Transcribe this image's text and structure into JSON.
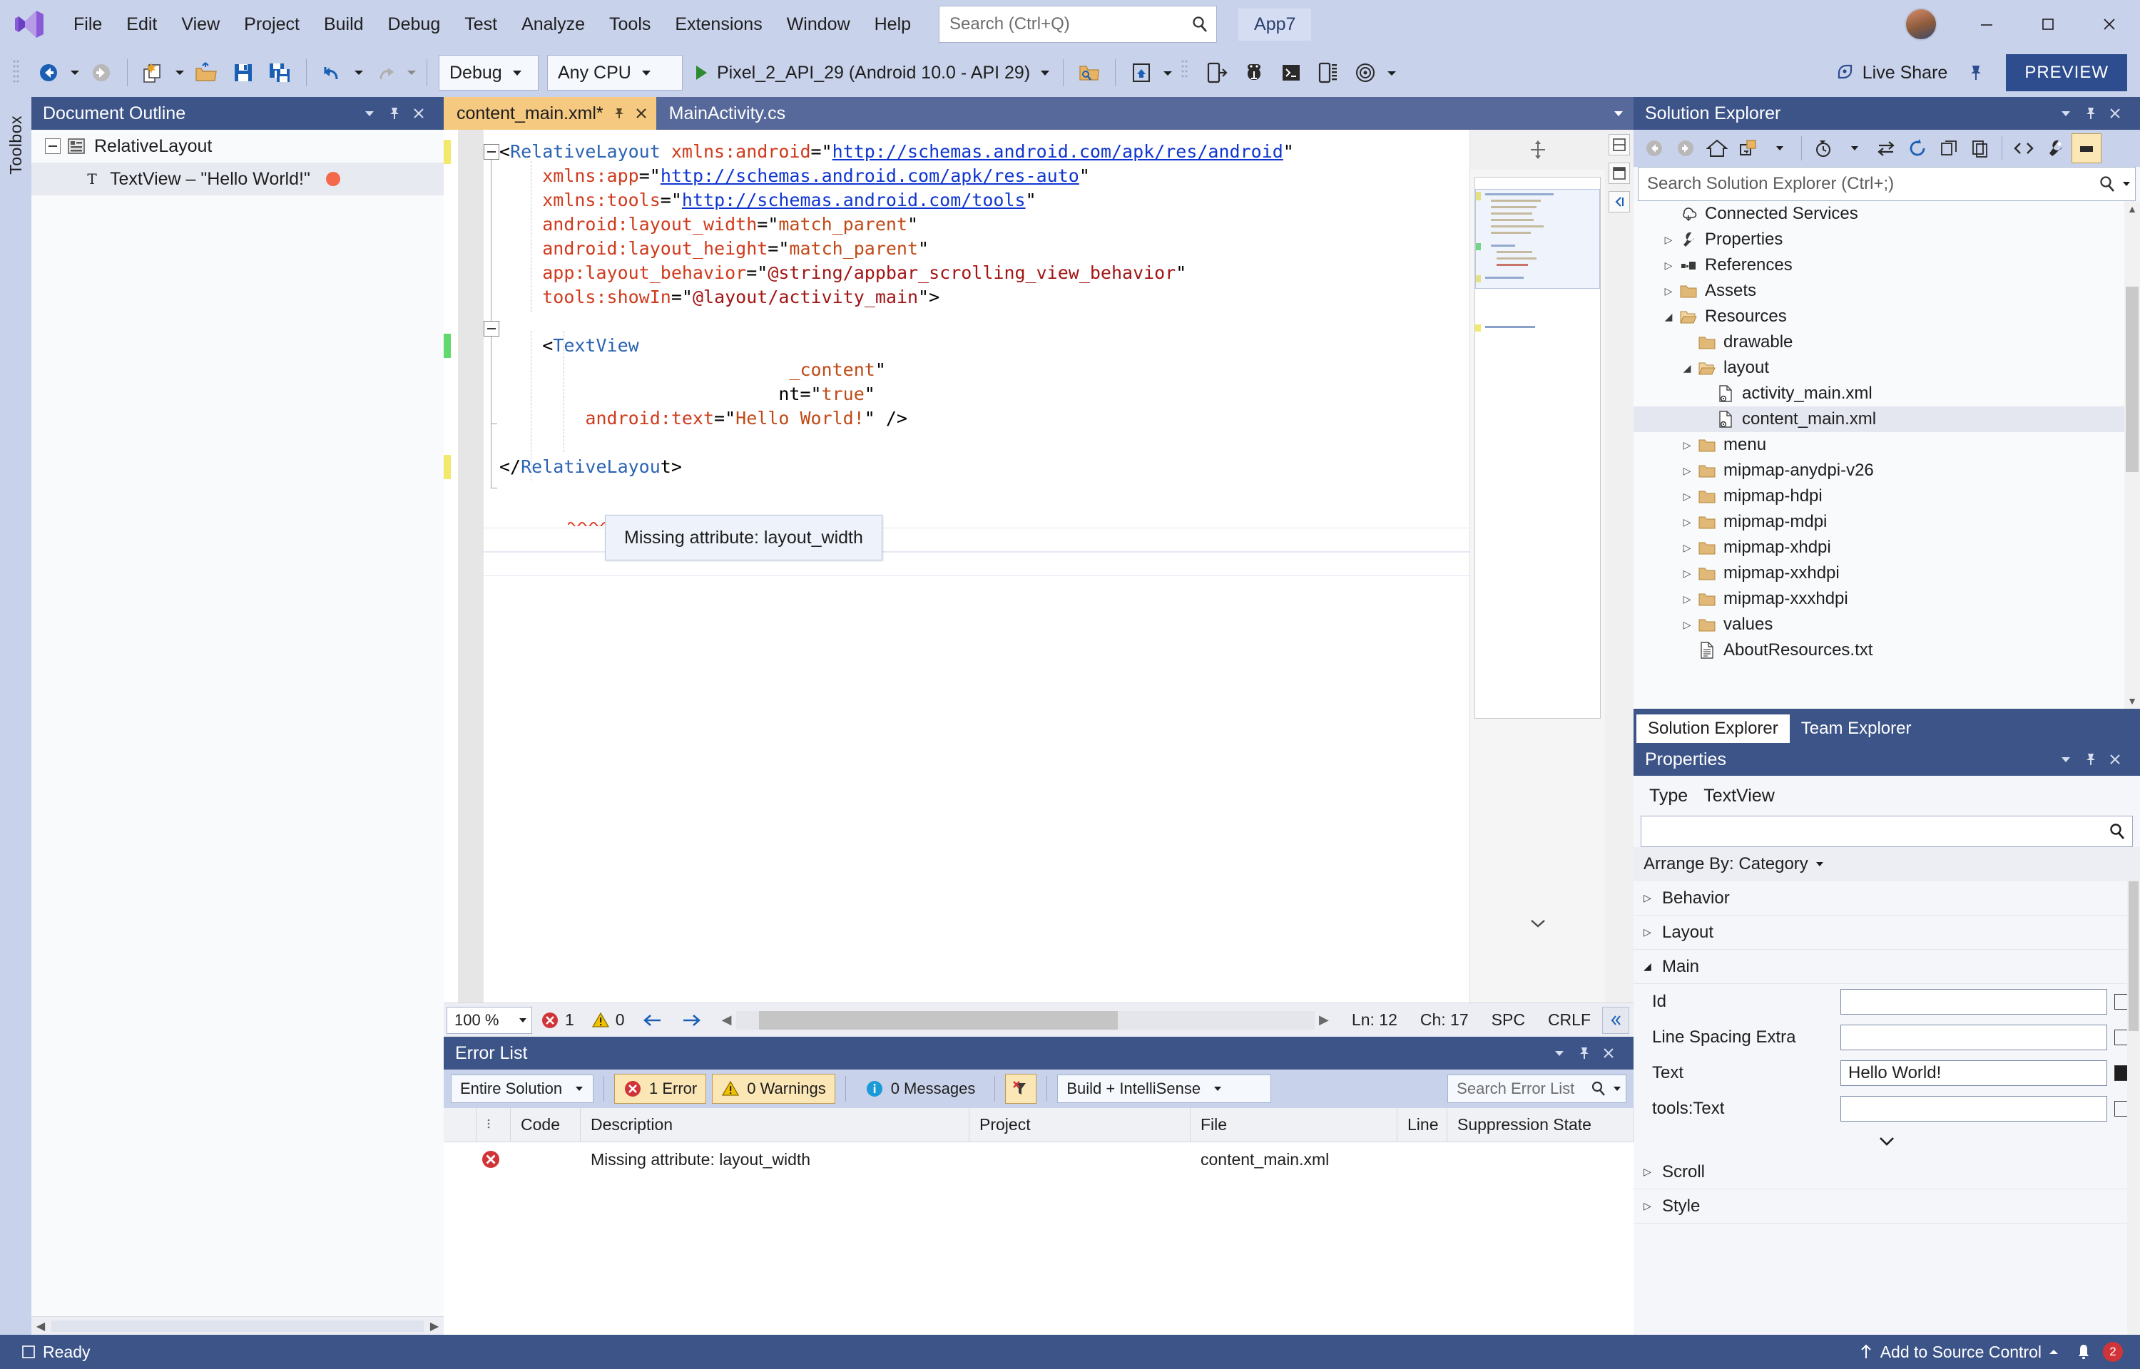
{
  "titlebar": {
    "logo_name": "visual-studio-logo",
    "menus": [
      "File",
      "Edit",
      "View",
      "Project",
      "Build",
      "Debug",
      "Test",
      "Analyze",
      "Tools",
      "Extensions",
      "Window",
      "Help"
    ],
    "search_placeholder": "Search (Ctrl+Q)",
    "project_badge": "App7",
    "minimize": "─",
    "maximize": "❐",
    "close": "✕"
  },
  "toolbar": {
    "configuration": "Debug",
    "platform": "Any CPU",
    "run_target": "Pixel_2_API_29 (Android 10.0 - API 29)",
    "live_share": "Live Share",
    "preview": "PREVIEW"
  },
  "toolbox": {
    "label": "Toolbox"
  },
  "document_outline": {
    "title": "Document Outline",
    "nodes": [
      {
        "label": "RelativeLayout",
        "icon": "layout-icon",
        "indent": 0,
        "selected": false,
        "dot": false
      },
      {
        "label": "TextView  –  \"Hello World!\"",
        "icon": "textview-icon",
        "indent": 1,
        "selected": true,
        "dot": true
      }
    ]
  },
  "editor": {
    "tabs": [
      {
        "label": "content_main.xml*",
        "active": true
      },
      {
        "label": "MainActivity.cs",
        "active": false
      }
    ],
    "tooltip": "Missing attribute: layout_width",
    "code_lines": [
      {
        "n": 1,
        "indent": 0,
        "tokens": [
          {
            "t": "punc",
            "v": "<"
          },
          {
            "t": "tag",
            "v": "RelativeLayout"
          },
          {
            "t": "plain",
            "v": " "
          },
          {
            "t": "attr",
            "v": "xmlns:android"
          },
          {
            "t": "punc",
            "v": "="
          },
          {
            "t": "strq",
            "v": "\""
          },
          {
            "t": "url",
            "v": "http://schemas.android.com/apk/res/android"
          },
          {
            "t": "strq",
            "v": "\""
          }
        ]
      },
      {
        "n": 2,
        "indent": 1,
        "tokens": [
          {
            "t": "attr",
            "v": "xmlns:app"
          },
          {
            "t": "punc",
            "v": "="
          },
          {
            "t": "strq",
            "v": "\""
          },
          {
            "t": "url",
            "v": "http://schemas.android.com/apk/res-auto"
          },
          {
            "t": "strq",
            "v": "\""
          }
        ]
      },
      {
        "n": 3,
        "indent": 1,
        "tokens": [
          {
            "t": "attr",
            "v": "xmlns:tools"
          },
          {
            "t": "punc",
            "v": "="
          },
          {
            "t": "strq",
            "v": "\""
          },
          {
            "t": "url",
            "v": "http://schemas.android.com/tools"
          },
          {
            "t": "strq",
            "v": "\""
          }
        ]
      },
      {
        "n": 4,
        "indent": 1,
        "tokens": [
          {
            "t": "attr",
            "v": "android:layout_width"
          },
          {
            "t": "punc",
            "v": "="
          },
          {
            "t": "strq",
            "v": "\""
          },
          {
            "t": "str",
            "v": "match_parent"
          },
          {
            "t": "strq",
            "v": "\""
          }
        ]
      },
      {
        "n": 5,
        "indent": 1,
        "tokens": [
          {
            "t": "attr",
            "v": "android:layout_height"
          },
          {
            "t": "punc",
            "v": "="
          },
          {
            "t": "strq",
            "v": "\""
          },
          {
            "t": "str",
            "v": "match_parent"
          },
          {
            "t": "strq",
            "v": "\""
          }
        ]
      },
      {
        "n": 6,
        "indent": 1,
        "tokens": [
          {
            "t": "attr",
            "v": "app:layout_behavior"
          },
          {
            "t": "punc",
            "v": "="
          },
          {
            "t": "strq",
            "v": "\""
          },
          {
            "t": "res",
            "v": "@string/appbar_scrolling_view_behavior"
          },
          {
            "t": "strq",
            "v": "\""
          }
        ]
      },
      {
        "n": 7,
        "indent": 1,
        "tokens": [
          {
            "t": "attr",
            "v": "tools:showIn"
          },
          {
            "t": "punc",
            "v": "="
          },
          {
            "t": "strq",
            "v": "\""
          },
          {
            "t": "res",
            "v": "@layout/activity_main"
          },
          {
            "t": "strq",
            "v": "\""
          },
          {
            "t": "punc",
            "v": ">"
          }
        ]
      },
      {
        "n": 8,
        "indent": 0,
        "tokens": []
      },
      {
        "n": 9,
        "indent": 1,
        "tokens": [
          {
            "t": "punc",
            "v": "<"
          },
          {
            "t": "tag",
            "v": "TextView"
          }
        ]
      },
      {
        "n": 10,
        "indent": 2,
        "tokens": [
          {
            "t": "plain",
            "v": "                   "
          },
          {
            "t": "str",
            "v": "_content"
          },
          {
            "t": "strq",
            "v": "\""
          }
        ]
      },
      {
        "n": 11,
        "indent": 2,
        "tokens": [
          {
            "t": "plain",
            "v": "                  nt="
          },
          {
            "t": "strq",
            "v": "\""
          },
          {
            "t": "str",
            "v": "true"
          },
          {
            "t": "strq",
            "v": "\""
          }
        ]
      },
      {
        "n": 12,
        "indent": 2,
        "tokens": [
          {
            "t": "attr",
            "v": "android:text"
          },
          {
            "t": "punc",
            "v": "="
          },
          {
            "t": "strq",
            "v": "\""
          },
          {
            "t": "str",
            "v": "Hello World!"
          },
          {
            "t": "strq",
            "v": "\""
          },
          {
            "t": "plain",
            "v": " "
          },
          {
            "t": "punc",
            "v": "/>"
          }
        ]
      },
      {
        "n": 13,
        "indent": 0,
        "tokens": []
      },
      {
        "n": 14,
        "indent": 0,
        "tokens": [
          {
            "t": "punc",
            "v": "</"
          },
          {
            "t": "tag",
            "v": "RelativeLayou"
          },
          {
            "t": "plain",
            "v": "t"
          },
          {
            "t": "punc",
            "v": ">"
          }
        ]
      }
    ],
    "status": {
      "zoom": "100 %",
      "error_count": "1",
      "warning_count": "0",
      "line": "Ln: 12",
      "col": "Ch: 17",
      "spaces": "SPC",
      "eol": "CRLF"
    }
  },
  "error_list": {
    "title": "Error List",
    "scope": "Entire Solution",
    "errors_label": "1 Error",
    "warnings_label": "0 Warnings",
    "messages_label": "0 Messages",
    "build_filter": "Build + IntelliSense",
    "search_placeholder": "Search Error List",
    "columns": [
      "",
      "",
      "Code",
      "Description",
      "Project",
      "File",
      "Line",
      "Suppression State"
    ],
    "rows": [
      {
        "severity": "error",
        "code": "",
        "description": "Missing attribute: layout_width",
        "project": "",
        "file": "content_main.xml",
        "line": "",
        "suppression": ""
      }
    ]
  },
  "solution_explorer": {
    "title": "Solution Explorer",
    "search_placeholder": "Search Solution Explorer (Ctrl+;)",
    "tree": [
      {
        "label": "Connected Services",
        "indent": 1,
        "expander": "none",
        "icon": "connected-services-icon",
        "selected": false
      },
      {
        "label": "Properties",
        "indent": 1,
        "expander": "collapsed",
        "icon": "wrench-icon",
        "selected": false
      },
      {
        "label": "References",
        "indent": 1,
        "expander": "collapsed",
        "icon": "references-icon",
        "selected": false
      },
      {
        "label": "Assets",
        "indent": 1,
        "expander": "collapsed",
        "icon": "folder-icon",
        "selected": false
      },
      {
        "label": "Resources",
        "indent": 1,
        "expander": "expanded",
        "icon": "folder-open-icon",
        "selected": false
      },
      {
        "label": "drawable",
        "indent": 2,
        "expander": "none",
        "icon": "folder-icon",
        "selected": false
      },
      {
        "label": "layout",
        "indent": 2,
        "expander": "expanded",
        "icon": "folder-open-icon",
        "selected": false
      },
      {
        "label": "activity_main.xml",
        "indent": 3,
        "expander": "none",
        "icon": "xml-file-icon",
        "selected": false
      },
      {
        "label": "content_main.xml",
        "indent": 3,
        "expander": "none",
        "icon": "xml-file-icon",
        "selected": true
      },
      {
        "label": "menu",
        "indent": 2,
        "expander": "collapsed",
        "icon": "folder-icon",
        "selected": false
      },
      {
        "label": "mipmap-anydpi-v26",
        "indent": 2,
        "expander": "collapsed",
        "icon": "folder-icon",
        "selected": false
      },
      {
        "label": "mipmap-hdpi",
        "indent": 2,
        "expander": "collapsed",
        "icon": "folder-icon",
        "selected": false
      },
      {
        "label": "mipmap-mdpi",
        "indent": 2,
        "expander": "collapsed",
        "icon": "folder-icon",
        "selected": false
      },
      {
        "label": "mipmap-xhdpi",
        "indent": 2,
        "expander": "collapsed",
        "icon": "folder-icon",
        "selected": false
      },
      {
        "label": "mipmap-xxhdpi",
        "indent": 2,
        "expander": "collapsed",
        "icon": "folder-icon",
        "selected": false
      },
      {
        "label": "mipmap-xxxhdpi",
        "indent": 2,
        "expander": "collapsed",
        "icon": "folder-icon",
        "selected": false
      },
      {
        "label": "values",
        "indent": 2,
        "expander": "collapsed",
        "icon": "folder-icon",
        "selected": false
      },
      {
        "label": "AboutResources.txt",
        "indent": 2,
        "expander": "none",
        "icon": "text-file-icon",
        "selected": false
      }
    ],
    "tabs": [
      {
        "label": "Solution Explorer",
        "active": true
      },
      {
        "label": "Team Explorer",
        "active": false
      }
    ]
  },
  "properties": {
    "title": "Properties",
    "type_label": "Type",
    "type_value": "TextView",
    "search_value": "",
    "arrange_by": "Arrange By: Category",
    "categories": [
      {
        "label": "Behavior",
        "state": "collapsed"
      },
      {
        "label": "Layout",
        "state": "collapsed"
      },
      {
        "label": "Main",
        "state": "expanded"
      }
    ],
    "main_rows": [
      {
        "label": "Id",
        "value": "",
        "mark": "empty"
      },
      {
        "label": "Line Spacing Extra",
        "value": "",
        "mark": "empty"
      },
      {
        "label": "Text",
        "value": "Hello World!",
        "mark": "filled"
      },
      {
        "label": "tools:Text",
        "value": "",
        "mark": "empty"
      }
    ],
    "bottom_categories": [
      {
        "label": "Scroll",
        "state": "collapsed"
      },
      {
        "label": "Style",
        "state": "collapsed"
      }
    ]
  },
  "statusbar": {
    "ready": "Ready",
    "source_control": "Add to Source Control",
    "notification_count": "2"
  },
  "colors": {
    "chrome": "#c8d2ea",
    "panel_title": "#3d5488",
    "tab_active": "#f5c980",
    "accent_blue": "#2b63b4",
    "error_red": "#d13438",
    "preview_blue": "#2d4d8f"
  }
}
